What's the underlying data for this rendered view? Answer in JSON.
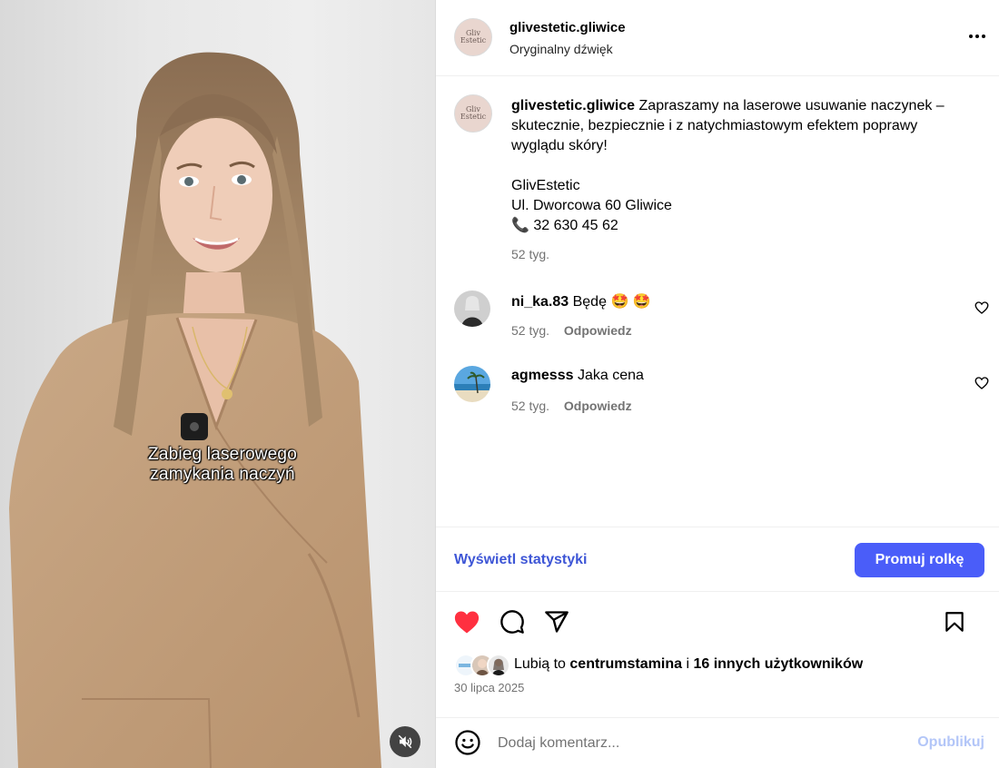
{
  "colors": {
    "accent": "#4a5df9",
    "link": "#3e56d6",
    "like_red": "#ff3040",
    "muted": "#737373"
  },
  "media": {
    "subtitle_line1": "Zabieg laserowego",
    "subtitle_line2": "zamykania naczyń",
    "mute_icon": "speaker-muted-icon"
  },
  "header": {
    "username": "glivestetic.gliwice",
    "audio": "Oryginalny dźwięk",
    "avatar_text_1": "Gliv",
    "avatar_text_2": "Estetic",
    "more_icon": "more-horizontal-icon"
  },
  "caption": {
    "username": "glivestetic.gliwice",
    "text": "Zapraszamy na laserowe usuwanie naczynek – skutecznie, bezpiecznie i z natychmiastowym efektem poprawy wyglądu skóry!",
    "line1": "GlivEstetic",
    "line2": "Ul. Dworcowa 60 Gliwice",
    "phone_emoji": "📞",
    "phone": "32 630 45 62",
    "time": "52 tyg."
  },
  "comments": [
    {
      "username": "ni_ka.83",
      "text": "Będę",
      "emoji": "🤩 🤩",
      "time": "52 tyg.",
      "reply": "Odpowiedz"
    },
    {
      "username": "agmesss",
      "text": "Jaka cena",
      "time": "52 tyg.",
      "reply": "Odpowiedz"
    }
  ],
  "stats": {
    "link": "Wyświetl statystyki",
    "promote": "Promuj rolkę"
  },
  "actions": {
    "liked": true,
    "icons": [
      "heart-filled-icon",
      "comment-icon",
      "share-icon",
      "bookmark-icon"
    ]
  },
  "likes": {
    "prefix": "Lubią to",
    "user": "centrumstamina",
    "mid": "i",
    "others": "16 innych użytkowników",
    "date": "30 lipca 2025"
  },
  "add_comment": {
    "placeholder": "Dodaj komentarz...",
    "publish": "Opublikuj"
  }
}
